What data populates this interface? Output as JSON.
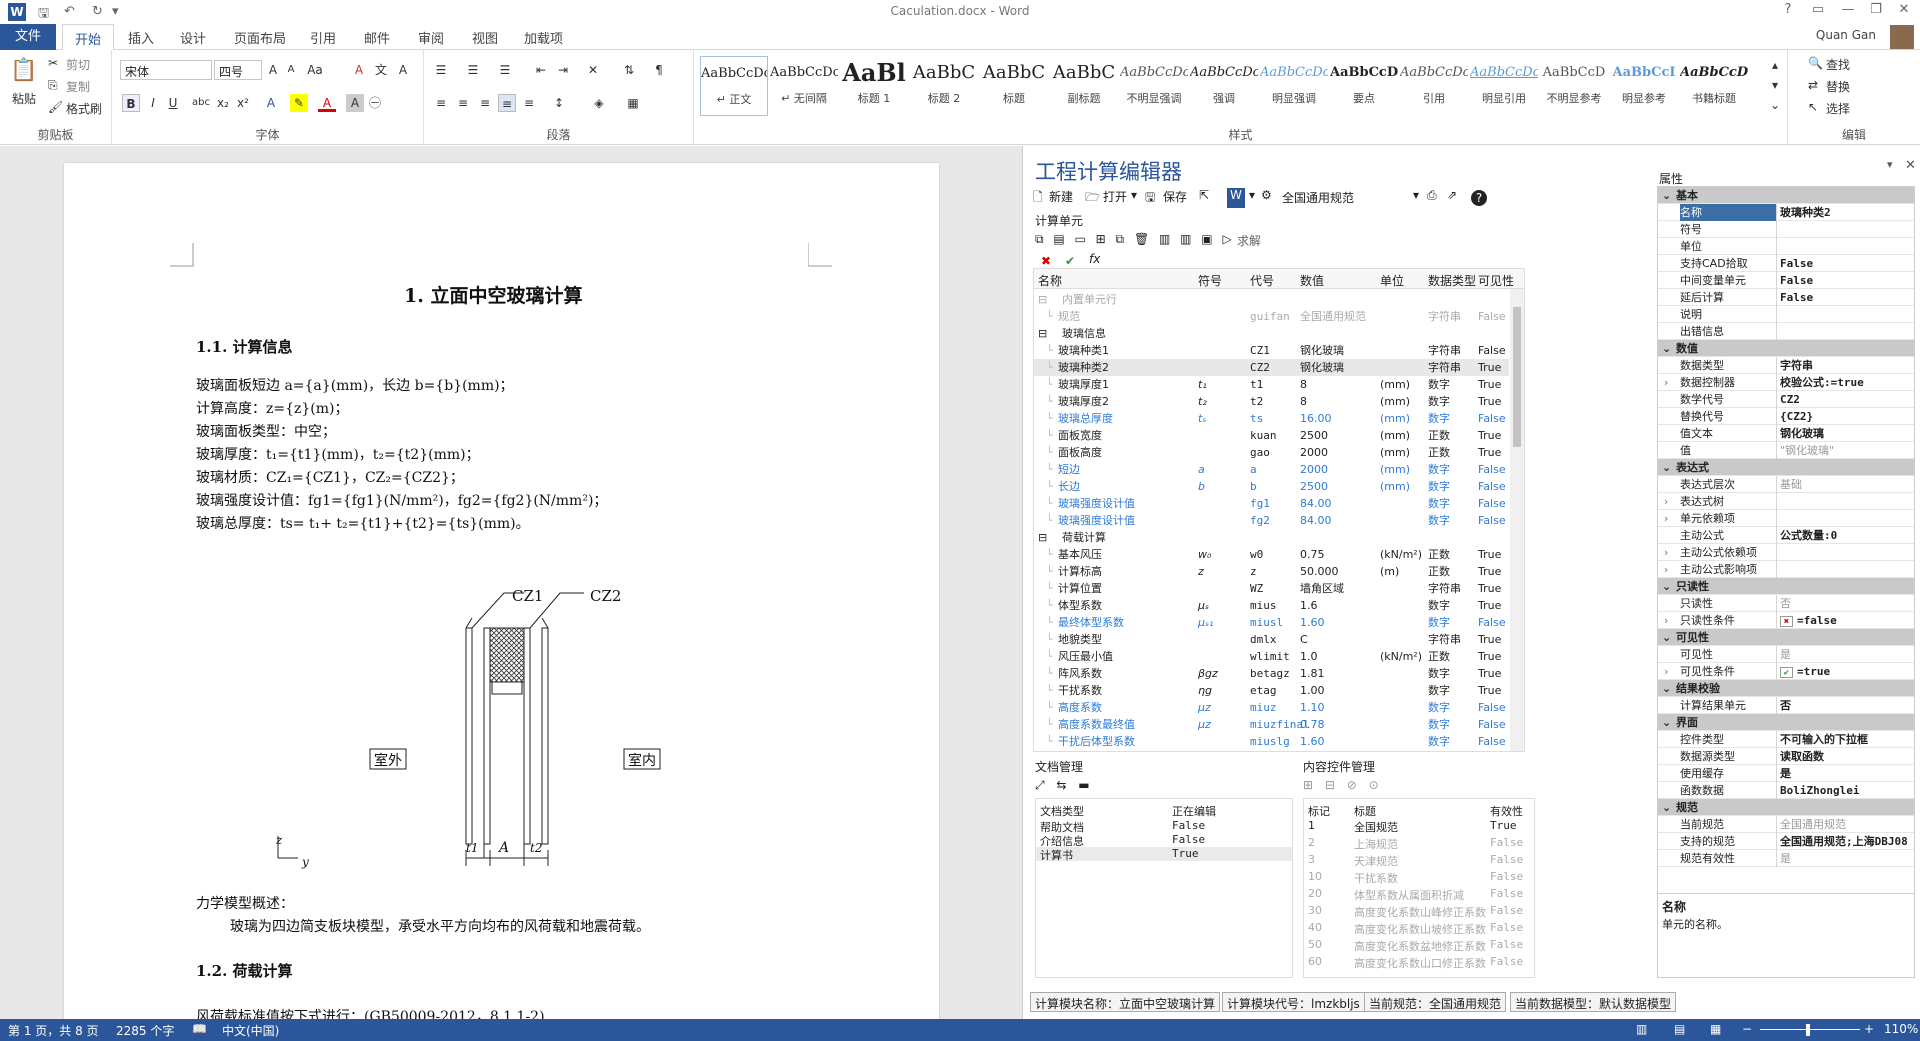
{
  "window": {
    "title": "Caculation.docx - Word",
    "help": "?",
    "user": "Quan Gan"
  },
  "tabs": [
    "文件",
    "开始",
    "插入",
    "设计",
    "页面布局",
    "引用",
    "邮件",
    "审阅",
    "视图",
    "加载项"
  ],
  "ribbon": {
    "clipboard": {
      "paste": "粘贴",
      "cut": "剪切",
      "copy": "复制",
      "format_painter": "格式刷",
      "label": "剪贴板"
    },
    "font": {
      "name": "宋体",
      "size": "四号",
      "label": "字体"
    },
    "paragraph": {
      "label": "段落"
    },
    "styles": {
      "label": "样式",
      "items": [
        {
          "preview": "AaBbCcDc",
          "name": "↵ 正文"
        },
        {
          "preview": "AaBbCcDc",
          "name": "↵ 无间隔"
        },
        {
          "preview": "AaBl",
          "name": "标题 1"
        },
        {
          "preview": "AaBbC",
          "name": "标题 2"
        },
        {
          "preview": "AaBbC",
          "name": "标题"
        },
        {
          "preview": "AaBbC",
          "name": "副标题"
        },
        {
          "preview": "AaBbCcDc",
          "name": "不明显强调"
        },
        {
          "preview": "AaBbCcDc",
          "name": "强调"
        },
        {
          "preview": "AaBbCcDc",
          "name": "明显强调"
        },
        {
          "preview": "AaBbCcD",
          "name": "要点"
        },
        {
          "preview": "AaBbCcDc",
          "name": "引用"
        },
        {
          "preview": "AaBbCcDc",
          "name": "明显引用"
        },
        {
          "preview": "AaBbCcD",
          "name": "不明显参考"
        },
        {
          "preview": "AaBbCcI",
          "name": "明显参考"
        },
        {
          "preview": "AaBbCcDc",
          "name": "书籍标题"
        }
      ]
    },
    "editing": {
      "find": "查找",
      "replace": "替换",
      "select": "选择",
      "label": "编辑"
    }
  },
  "document": {
    "heading1": "1.   立面中空玻璃计算",
    "h11": "1.1.  计算信息",
    "lines": [
      "玻璃面板短边 a={a}(mm)，长边 b={b}(mm)；",
      "计算高度：z={z}(m)；",
      "玻璃面板类型：中空；",
      "玻璃厚度：t₁={t1}(mm)，t₂={t2}(mm)；",
      "玻璃材质：CZ₁={CZ1}，CZ₂={CZ2}；",
      "玻璃强度设计值：fg1={fg1}(N/mm²)，fg2={fg2}(N/mm²)；",
      "玻璃总厚度：ts= t₁+ t₂={t1}+{t2}={ts}(mm)。"
    ],
    "figure": {
      "cz1": "CZ1",
      "cz2": "CZ2",
      "outside": "室外",
      "inside": "室内",
      "t1": "t1",
      "a": "A",
      "t2": "t2",
      "z": "z",
      "y": "y"
    },
    "mech_title": "力学模型概述：",
    "mech_text": "玻璃为四边简支板块模型，承受水平方向均布的风荷载和地震荷载。",
    "h12": "1.2.  荷载计算",
    "last_line": "风荷载标准值按下式进行：(GB50009-2012，8.1.1-2)"
  },
  "panel": {
    "title": "工程计算编辑器",
    "toolbar": {
      "new": "新建",
      "open": "打开",
      "save": "保存",
      "spec": "全国通用规范"
    },
    "units_label": "计算单元",
    "solve": "求解",
    "columns": [
      "名称",
      "符号",
      "代号",
      "数值",
      "单位",
      "数据类型",
      "可见性"
    ],
    "rows": [
      {
        "indent": 0,
        "group": true,
        "name": "内置单元行",
        "sym": "",
        "code": "",
        "val": "",
        "unit": "",
        "type": "",
        "vis": "",
        "style": "gray"
      },
      {
        "indent": 1,
        "name": "规范",
        "sym": "",
        "code": "guifan",
        "val": "全国通用规范",
        "unit": "",
        "type": "字符串",
        "vis": "False",
        "style": "gray"
      },
      {
        "indent": 0,
        "group": true,
        "name": "玻璃信息",
        "sym": "",
        "code": "",
        "val": "",
        "unit": "",
        "type": "",
        "vis": "",
        "style": ""
      },
      {
        "indent": 1,
        "name": "玻璃种类1",
        "sym": "",
        "code": "CZ1",
        "val": "钢化玻璃",
        "unit": "",
        "type": "字符串",
        "vis": "False",
        "style": ""
      },
      {
        "indent": 1,
        "name": "玻璃种类2",
        "sym": "",
        "code": "CZ2",
        "val": "钢化玻璃",
        "unit": "",
        "type": "字符串",
        "vis": "True",
        "style": "sel"
      },
      {
        "indent": 1,
        "name": "玻璃厚度1",
        "sym": "t₁",
        "code": "t1",
        "val": "8",
        "unit": "(mm)",
        "type": "数字",
        "vis": "True",
        "style": ""
      },
      {
        "indent": 1,
        "name": "玻璃厚度2",
        "sym": "t₂",
        "code": "t2",
        "val": "8",
        "unit": "(mm)",
        "type": "数字",
        "vis": "True",
        "style": ""
      },
      {
        "indent": 1,
        "name": "玻璃总厚度",
        "sym": "tₛ",
        "code": "ts",
        "val": "16.00",
        "unit": "(mm)",
        "type": "数字",
        "vis": "False",
        "style": "blue"
      },
      {
        "indent": 1,
        "name": "面板宽度",
        "sym": "",
        "code": "kuan",
        "val": "2500",
        "unit": "(mm)",
        "type": "正数",
        "vis": "True",
        "style": ""
      },
      {
        "indent": 1,
        "name": "面板高度",
        "sym": "",
        "code": "gao",
        "val": "2000",
        "unit": "(mm)",
        "type": "正数",
        "vis": "True",
        "style": ""
      },
      {
        "indent": 1,
        "name": "短边",
        "sym": "a",
        "code": "a",
        "val": "2000",
        "unit": "(mm)",
        "type": "数字",
        "vis": "False",
        "style": "blue"
      },
      {
        "indent": 1,
        "name": "长边",
        "sym": "b",
        "code": "b",
        "val": "2500",
        "unit": "(mm)",
        "type": "数字",
        "vis": "False",
        "style": "blue"
      },
      {
        "indent": 1,
        "name": "玻璃强度设计值",
        "sym": "",
        "code": "fg1",
        "val": "84.00",
        "unit": "",
        "type": "数字",
        "vis": "False",
        "style": "blue"
      },
      {
        "indent": 1,
        "name": "玻璃强度设计值",
        "sym": "",
        "code": "fg2",
        "val": "84.00",
        "unit": "",
        "type": "数字",
        "vis": "False",
        "style": "blue"
      },
      {
        "indent": 0,
        "group": true,
        "name": "荷载计算",
        "sym": "",
        "code": "",
        "val": "",
        "unit": "",
        "type": "",
        "vis": "",
        "style": ""
      },
      {
        "indent": 1,
        "name": "基本风压",
        "sym": "w₀",
        "code": "w0",
        "val": "0.75",
        "unit": "(kN/m²)",
        "type": "正数",
        "vis": "True",
        "style": ""
      },
      {
        "indent": 1,
        "name": "计算标高",
        "sym": "z",
        "code": "z",
        "val": "50.000",
        "unit": "(m)",
        "type": "正数",
        "vis": "True",
        "style": ""
      },
      {
        "indent": 1,
        "name": "计算位置",
        "sym": "",
        "code": "WZ",
        "val": "墙角区域",
        "unit": "",
        "type": "字符串",
        "vis": "True",
        "style": ""
      },
      {
        "indent": 1,
        "name": "体型系数",
        "sym": "μₛ",
        "code": "mius",
        "val": "1.6",
        "unit": "",
        "type": "数字",
        "vis": "True",
        "style": ""
      },
      {
        "indent": 1,
        "name": "最终体型系数",
        "sym": "μₛ₁",
        "code": "miusl",
        "val": "1.60",
        "unit": "",
        "type": "数字",
        "vis": "False",
        "style": "blue"
      },
      {
        "indent": 1,
        "name": "地貌类型",
        "sym": "",
        "code": "dmlx",
        "val": "C",
        "unit": "",
        "type": "字符串",
        "vis": "True",
        "style": ""
      },
      {
        "indent": 1,
        "name": "风压最小值",
        "sym": "",
        "code": "wlimit",
        "val": "1.0",
        "unit": "(kN/m²)",
        "type": "正数",
        "vis": "True",
        "style": ""
      },
      {
        "indent": 1,
        "name": "阵风系数",
        "sym": "βgz",
        "code": "betagz",
        "val": "1.81",
        "unit": "",
        "type": "数字",
        "vis": "True",
        "style": ""
      },
      {
        "indent": 1,
        "name": "干扰系数",
        "sym": "ηg",
        "code": "etag",
        "val": "1.00",
        "unit": "",
        "type": "数字",
        "vis": "True",
        "style": ""
      },
      {
        "indent": 1,
        "name": "高度系数",
        "sym": "μz",
        "code": "miuz",
        "val": "1.10",
        "unit": "",
        "type": "数字",
        "vis": "False",
        "style": "blue"
      },
      {
        "indent": 1,
        "name": "高度系数最终值",
        "sym": "μz",
        "code": "miuzfinal",
        "val": "0.78",
        "unit": "",
        "type": "数字",
        "vis": "False",
        "style": "blue"
      },
      {
        "indent": 1,
        "name": "干扰后体型系数",
        "sym": "",
        "code": "miuslg",
        "val": "1.60",
        "unit": "",
        "type": "数字",
        "vis": "False",
        "style": "blue"
      }
    ],
    "doc_mgmt": {
      "label": "文档管理",
      "columns": [
        "文档类型",
        "正在编辑"
      ],
      "rows": [
        [
          "帮助文档",
          "False"
        ],
        [
          "介绍信息",
          "False"
        ],
        [
          "计算书",
          "True"
        ]
      ]
    },
    "content_ctrl": {
      "label": "内容控件管理",
      "columns": [
        "标记",
        "标题",
        "有效性"
      ],
      "rows": [
        [
          "1",
          "全国规范",
          "True",
          ""
        ],
        [
          "2",
          "上海规范",
          "False",
          "gray"
        ],
        [
          "3",
          "天津规范",
          "False",
          "gray"
        ],
        [
          "10",
          "干扰系数",
          "False",
          "gray"
        ],
        [
          "20",
          "体型系数从属面积折减",
          "False",
          "gray"
        ],
        [
          "30",
          "高度变化系数山峰修正系数",
          "False",
          "gray"
        ],
        [
          "40",
          "高度变化系数山坡修正系数",
          "False",
          "gray"
        ],
        [
          "50",
          "高度变化系数盆地修正系数",
          "False",
          "gray"
        ],
        [
          "60",
          "高度变化系数山口修正系数",
          "False",
          "gray"
        ]
      ]
    },
    "status_segments": [
      "计算模块名称：立面中空玻璃计算",
      "计算模块代号：lmzkbljs",
      "当前规范：全国通用规范",
      "当前数据模型：默认数据模型"
    ],
    "properties": {
      "label": "属性",
      "rows": [
        {
          "cat": true,
          "k": "基本"
        },
        {
          "k": "名称",
          "v": "玻璃种类2",
          "sel": true
        },
        {
          "k": "符号",
          "v": ""
        },
        {
          "k": "单位",
          "v": ""
        },
        {
          "k": "支持CAD拾取",
          "v": "False"
        },
        {
          "k": "中间变量单元",
          "v": "False"
        },
        {
          "k": "延后计算",
          "v": "False"
        },
        {
          "k": "说明",
          "v": ""
        },
        {
          "k": "出错信息",
          "v": ""
        },
        {
          "cat": true,
          "k": "数值"
        },
        {
          "k": "数据类型",
          "v": "字符串"
        },
        {
          "k": "数据控制器",
          "v": "校验公式:=true",
          "exp": true
        },
        {
          "k": "数学代号",
          "v": "CZ2"
        },
        {
          "k": "替换代号",
          "v": "{CZ2}"
        },
        {
          "k": "值文本",
          "v": "钢化玻璃"
        },
        {
          "k": "值",
          "v": "\"钢化玻璃\"",
          "g": true
        },
        {
          "cat": true,
          "k": "表达式"
        },
        {
          "k": "表达式层次",
          "v": "基础",
          "g": true
        },
        {
          "k": "表达式树",
          "v": "",
          "exp": true
        },
        {
          "k": "单元依赖项",
          "v": "",
          "exp": true
        },
        {
          "k": "主动公式",
          "v": "公式数量:0"
        },
        {
          "k": "主动公式依赖项",
          "v": "",
          "exp": true
        },
        {
          "k": "主动公式影响项",
          "v": "",
          "exp": true
        },
        {
          "cat": true,
          "k": "只读性"
        },
        {
          "k": "只读性",
          "v": "否",
          "g": true
        },
        {
          "k": "只读性条件",
          "v": "=false",
          "exp": true,
          "box": "x"
        },
        {
          "cat": true,
          "k": "可见性"
        },
        {
          "k": "可见性",
          "v": "是",
          "g": true
        },
        {
          "k": "可见性条件",
          "v": "=true",
          "exp": true,
          "box": "check"
        },
        {
          "cat": true,
          "k": "结果校验"
        },
        {
          "k": "计算结果单元",
          "v": "否"
        },
        {
          "cat": true,
          "k": "界面"
        },
        {
          "k": "控件类型",
          "v": "不可输入的下拉框"
        },
        {
          "k": "数据源类型",
          "v": "读取函数"
        },
        {
          "k": "使用缓存",
          "v": "是"
        },
        {
          "k": "函数数据",
          "v": "BoliZhonglei"
        },
        {
          "cat": true,
          "k": "规范"
        },
        {
          "k": "当前规范",
          "v": "全国通用规范",
          "g": true
        },
        {
          "k": "支持的规范",
          "v": "全国通用规范;上海DBJ08"
        },
        {
          "k": "规范有效性",
          "v": "是",
          "g": true
        }
      ],
      "desc_title": "名称",
      "desc_text": "单元的名称。"
    }
  },
  "statusbar": {
    "page": "第 1 页，共 8 页",
    "words": "2285 个字",
    "lang": "中文(中国)",
    "zoom": "110%"
  }
}
